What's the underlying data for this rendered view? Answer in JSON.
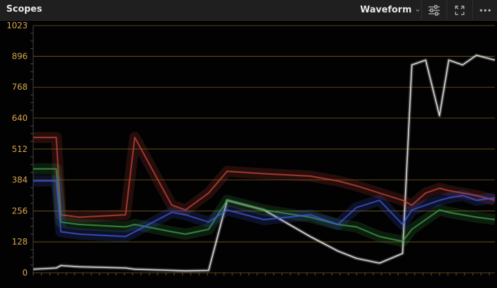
{
  "header": {
    "title": "Scopes",
    "mode_label": "Waveform",
    "icons": [
      "chevron-down-icon",
      "settings-sliders-icon",
      "expand-icon",
      "more-options-icon"
    ]
  },
  "scope": {
    "axis_labels": [
      "1023",
      "896",
      "768",
      "640",
      "512",
      "384",
      "256",
      "128",
      "0"
    ],
    "axis_label_color": "#d9a64a",
    "graticule_color": "#8a6d1e"
  },
  "chart_data": {
    "type": "line",
    "ylim": [
      0,
      1023
    ],
    "yticks": [
      0,
      128,
      256,
      384,
      512,
      640,
      768,
      896,
      1023
    ],
    "grid": true,
    "x": [
      0,
      0.05,
      0.06,
      0.1,
      0.2,
      0.22,
      0.3,
      0.33,
      0.38,
      0.42,
      0.5,
      0.6,
      0.66,
      0.7,
      0.75,
      0.8,
      0.82,
      0.85,
      0.88,
      0.9,
      0.93,
      0.96,
      1
    ],
    "series": [
      {
        "color": "#e8e8e8",
        "values": [
          15,
          20,
          30,
          25,
          20,
          15,
          10,
          8,
          10,
          300,
          260,
          150,
          90,
          60,
          40,
          80,
          860,
          880,
          650,
          880,
          860,
          900,
          880
        ]
      },
      {
        "color": "#c2433a",
        "values": [
          560,
          560,
          240,
          230,
          240,
          560,
          280,
          260,
          330,
          420,
          410,
          400,
          380,
          360,
          330,
          300,
          280,
          330,
          350,
          340,
          330,
          320,
          300
        ]
      },
      {
        "color": "#3c9d4a",
        "values": [
          430,
          430,
          210,
          200,
          190,
          200,
          170,
          160,
          180,
          300,
          260,
          230,
          200,
          190,
          150,
          130,
          180,
          220,
          260,
          250,
          240,
          230,
          220
        ]
      },
      {
        "color": "#3e57d8",
        "values": [
          380,
          380,
          170,
          160,
          150,
          170,
          250,
          240,
          210,
          260,
          220,
          240,
          200,
          270,
          300,
          200,
          260,
          280,
          300,
          310,
          320,
          300,
          310
        ]
      }
    ]
  }
}
